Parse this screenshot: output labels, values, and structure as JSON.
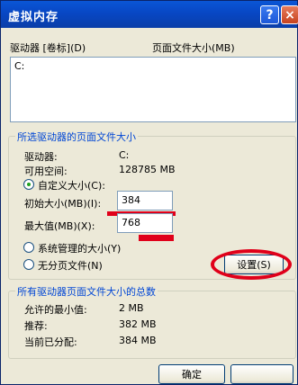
{
  "window": {
    "title": "虚拟内存",
    "help_label": "?",
    "close_label": "×"
  },
  "drive_list": {
    "header_drive": "驱动器 [卷标](D)",
    "header_paging": "页面文件大小(MB)",
    "items": [
      "C:"
    ]
  },
  "selected_drive": {
    "group_title": "所选驱动器的页面文件大小",
    "drive_label": "驱动器:",
    "drive_value": "C:",
    "space_label": "可用空间:",
    "space_value": "128785 MB",
    "custom_size_label": "自定义大小(C):",
    "initial_label": "初始大小(MB)(I):",
    "initial_value": "384",
    "max_label": "最大值(MB)(X):",
    "max_value": "768",
    "system_managed_label": "系统管理的大小(Y)",
    "no_paging_label": "无分页文件(N)",
    "set_button": "设置(S)"
  },
  "totals": {
    "group_title": "所有驱动器页面文件大小的总数",
    "min_label": "允许的最小值:",
    "min_value": "2 MB",
    "recommended_label": "推荐:",
    "recommended_value": "382 MB",
    "current_label": "当前已分配:",
    "current_value": "384 MB"
  },
  "footer": {
    "ok_button": "确定"
  },
  "colors": {
    "title_bar": "#0a56d6",
    "annotation_red": "#e0001a",
    "group_title": "#0046d5"
  }
}
